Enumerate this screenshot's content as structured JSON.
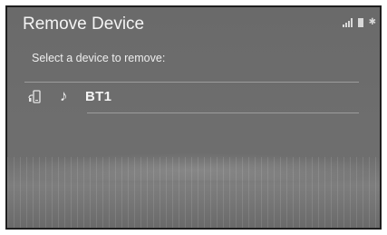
{
  "header": {
    "title": "Remove Device"
  },
  "status_bar": {
    "icons": [
      "signal-icon",
      "battery-icon",
      "bluetooth-icon"
    ],
    "bluetooth_glyph": "✱"
  },
  "prompt": "Select a device to remove:",
  "devices": [
    {
      "name": "BT1",
      "icons": [
        "phone-icon",
        "music-icon"
      ],
      "music_glyph": "♪"
    }
  ],
  "colors": {
    "screen_background": "#6c6c6c",
    "text": "#f2f2f2",
    "separator": "#9c9c9c",
    "frame": "#1e1e1e"
  }
}
